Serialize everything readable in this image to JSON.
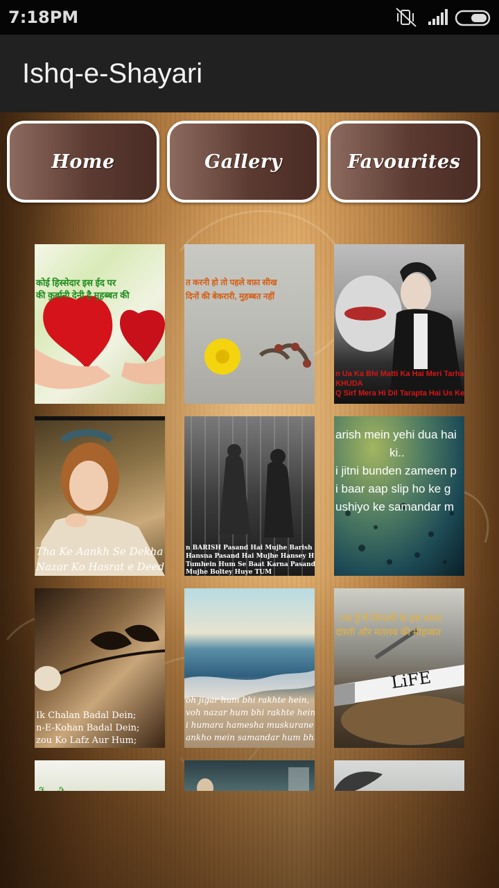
{
  "status_bar": {
    "time": "7:18PM",
    "icons": [
      "vibrate-off-icon",
      "signal-icon",
      "battery-icon"
    ]
  },
  "app_bar": {
    "title": "Ishq-e-Shayari"
  },
  "tabs": [
    {
      "label": "Home"
    },
    {
      "label": "Gallery"
    },
    {
      "label": "Favourites"
    }
  ],
  "gallery": {
    "images": [
      {
        "lines": [
          "कोई हिस्सेदार इस ईद पर",
          "की कुर्बानी देनी है मुहब्बत की"
        ]
      },
      {
        "lines": [
          "त करनी हो तो पहले वफ़ा सीख",
          "दिनों की बेकरारी, मुहब्बत नहीं"
        ]
      },
      {
        "lines": [
          "n Ua Ka Bhi Matti Ka Hai Meri Tarha",
          "KHUDA",
          "Q Sirf Mera Hi Dil Tarapta Hai Us Ke L"
        ]
      },
      {
        "lines": [
          "Tha Ke Aankh Se Dekha",
          "Nazar Ko Hasrat e Deed"
        ]
      },
      {
        "lines": [
          "n BARISH Pasand Hai Mujhe Barish Me",
          "Hansna Pasand Hai Mujhe Hansey Hu",
          "Tumhein Hum Se Baat Karna Pasand Ha",
          "Mujhe Boltey Huye TUM"
        ]
      },
      {
        "lines": [
          "arish mein yehi dua hai",
          "ki..",
          "i jitni bunden zameen p",
          "i baar aap slip ho ke g",
          "ushiyo ke samandar m"
        ]
      },
      {
        "lines": [
          "Ik Chalan Badal Dein;",
          "n-E-Kohan Badal Dein;",
          "zou Ko Lafz Aur Hum;"
        ]
      },
      {
        "lines": [
          "oh jigar hum bhi rakhte hein,",
          "voh nazar hum bhi rakhte hein,",
          "i humara hamesha muskurane ka,",
          "ankho mein samandar hum bhi ra"
        ]
      },
      {
        "lines": [
          "ाया हूँ मैं जिन्दगी के इस सफर",
          "दोस्ती और मतलब की मोहब्बत",
          "LiFE"
        ]
      },
      {
        "lines": [
          "ीं ... ी"
        ]
      },
      {
        "lines": []
      },
      {
        "lines": []
      }
    ]
  },
  "colors": {
    "status_bar": "#050505",
    "app_bar": "#212121",
    "tab_border": "#ffffff",
    "tab_fill": "#5b3a31"
  }
}
